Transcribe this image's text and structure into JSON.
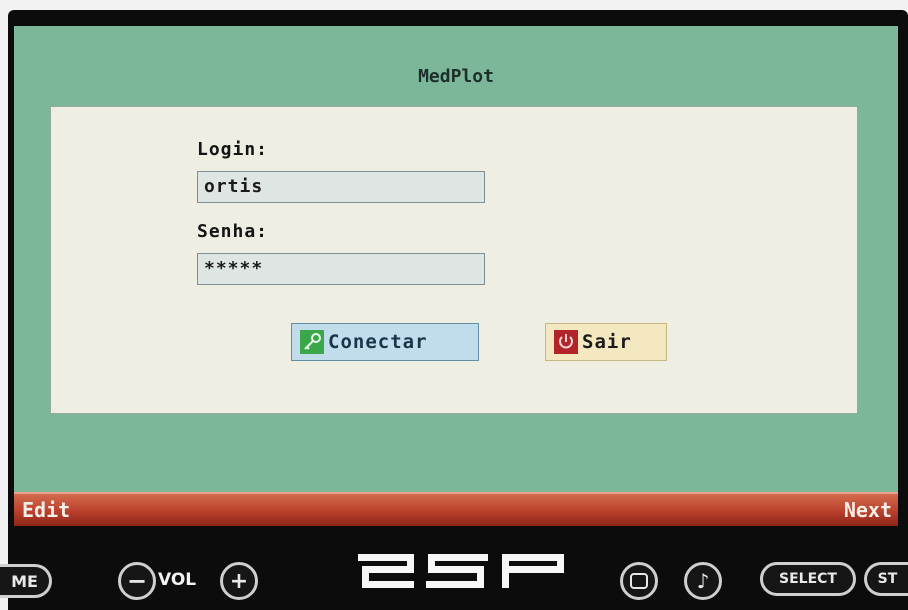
{
  "app": {
    "title": "MedPlot"
  },
  "login": {
    "login_label": "Login:",
    "login_value": "ortis",
    "password_label": "Senha:",
    "password_masked": "*****"
  },
  "buttons": {
    "connect_label": "Conectar",
    "exit_label": "Sair"
  },
  "softkeys": {
    "left": "Edit",
    "right": "Next"
  },
  "hardware": {
    "home_label": "ME",
    "minus": "−",
    "vol_label": "VOL",
    "plus": "+",
    "logo": "PSP",
    "music": "♪",
    "select_label": "SELECT",
    "start_label": "ST"
  },
  "colors": {
    "screen_bg": "#7cb79a",
    "panel_bg": "#eeeee3",
    "softbar": "#b9402c",
    "connect_btn": "#c1dceb",
    "exit_btn": "#f3e8bf"
  }
}
